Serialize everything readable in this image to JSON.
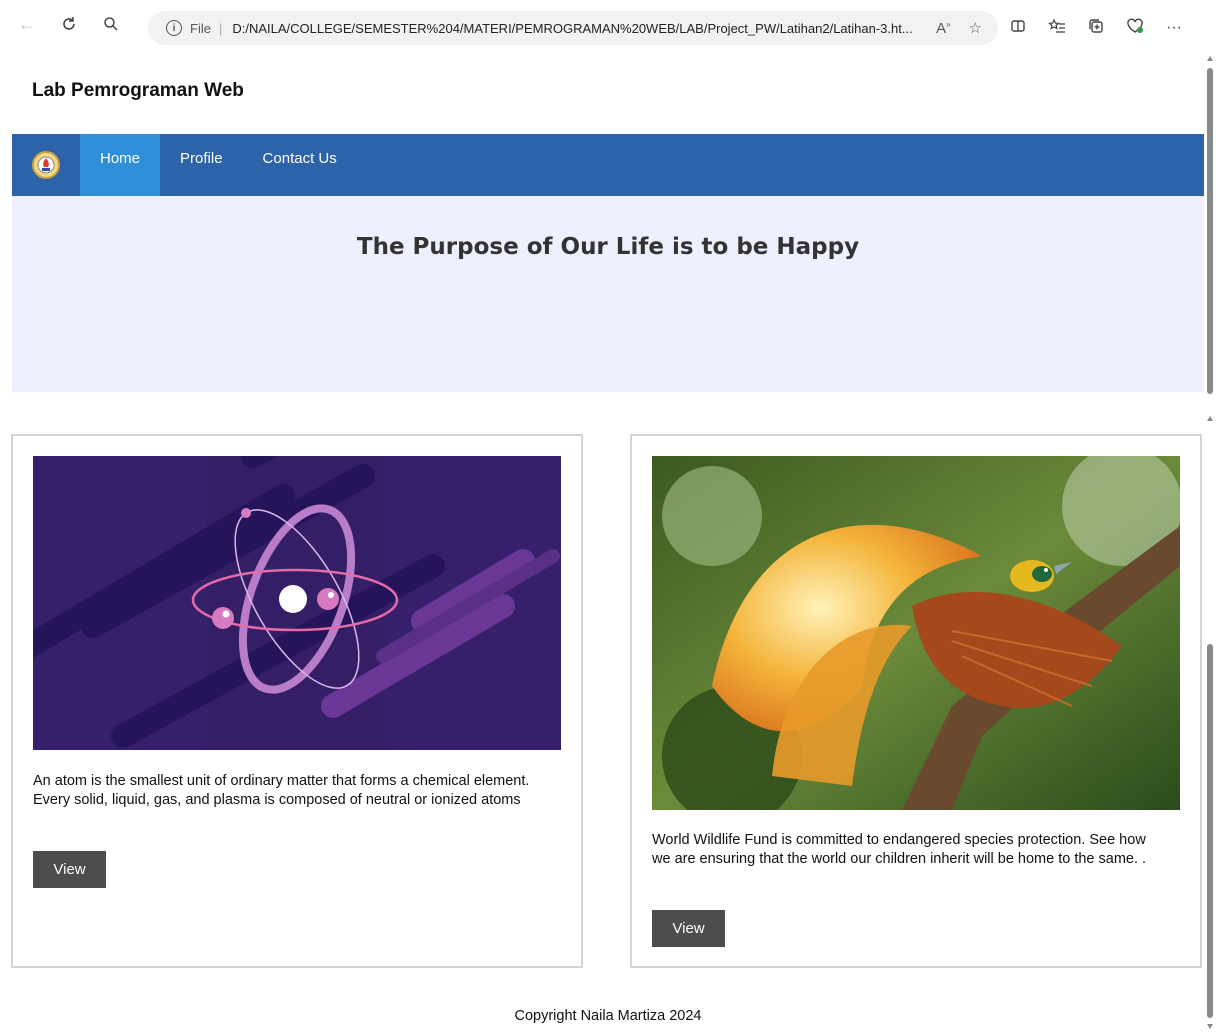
{
  "browser": {
    "scheme_label": "File",
    "url": "D:/NAILA/COLLEGE/SEMESTER%204/MATERI/PEMROGRAMAN%20WEB/LAB/Project_PW/Latihan2/Latihan-3.ht...",
    "icons": [
      "back-icon",
      "refresh-icon",
      "search-icon",
      "info-icon",
      "read-aloud-icon",
      "favorite-star-icon",
      "split-screen-icon",
      "favorites-icon",
      "collections-icon",
      "health-icon",
      "more-icon"
    ]
  },
  "site": {
    "title": "Lab Pemrograman Web"
  },
  "nav": {
    "items": [
      {
        "label": "Home",
        "active": true
      },
      {
        "label": "Profile",
        "active": false
      },
      {
        "label": "Contact Us",
        "active": false
      }
    ]
  },
  "hero": {
    "title": "The Purpose of Our Life is to be Happy"
  },
  "cards": [
    {
      "text": "An atom is the smallest unit of ordinary matter that forms a chemical element. Every solid, liquid, gas, and plasma is composed of neutral or ionized atoms",
      "button_label": "View"
    },
    {
      "text": "World Wildlife Fund is committed to endangered species protection. See how we are ensuring that the world our children inherit will be home to the same. .",
      "button_label": "View"
    }
  ],
  "footer": {
    "text": "Copyright Naila Martiza 2024"
  },
  "colors": {
    "nav_bg": "#2d63a8",
    "nav_active": "#2f8fd8",
    "hero_bg": "#eef0fd",
    "button_bg": "#4d4d4d"
  }
}
